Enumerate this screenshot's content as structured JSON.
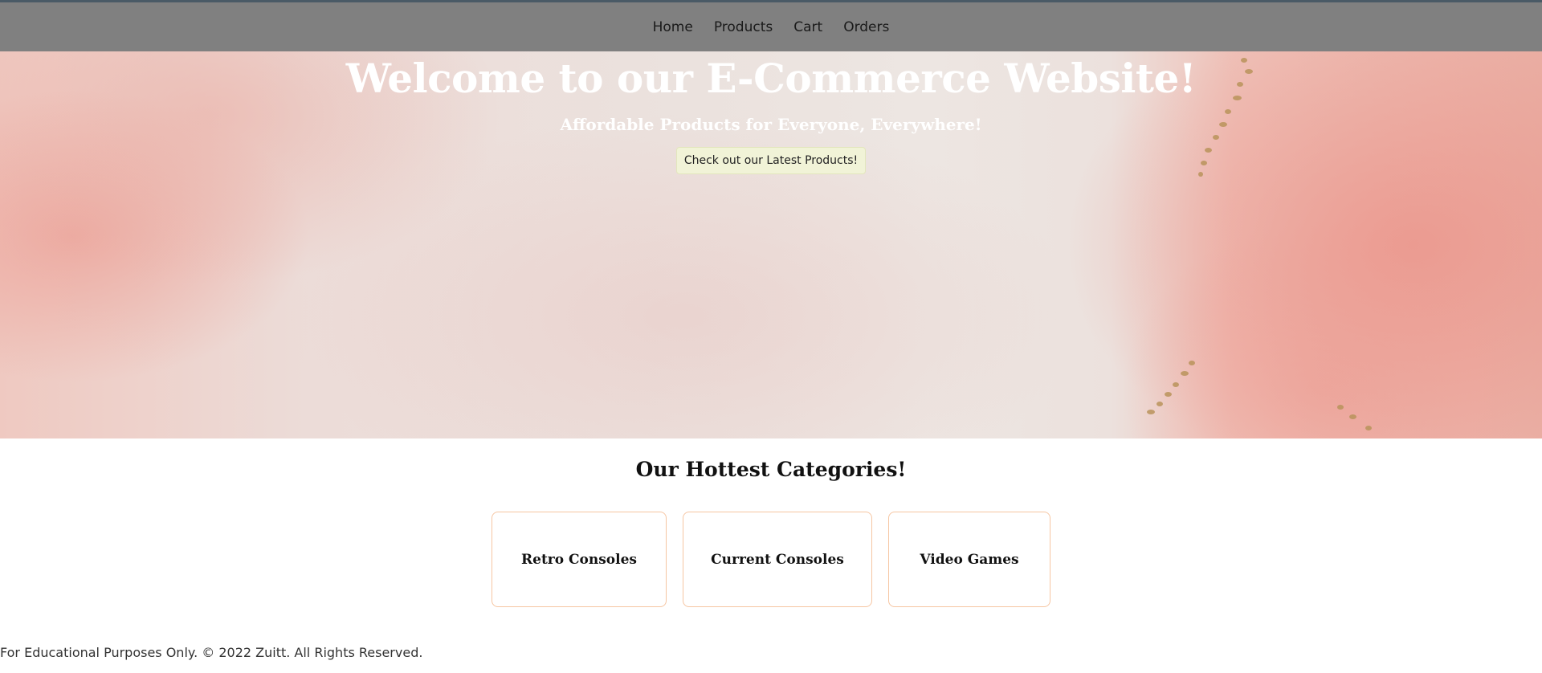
{
  "nav": {
    "links": [
      "Home",
      "Products",
      "Cart",
      "Orders"
    ]
  },
  "hero": {
    "title": "Welcome to our E-Commerce Website!",
    "subtitle": "Affordable Products for Everyone, Everywhere!",
    "button_label": "Check out our Latest Products!"
  },
  "categories": {
    "title": "Our Hottest Categories!",
    "items": [
      "Retro Consoles",
      "Current Consoles",
      "Video Games"
    ]
  },
  "footer": {
    "text": "For Educational Purposes Only. © 2022 Zuitt. All Rights Reserved."
  },
  "colors": {
    "navbar": "#808080",
    "card_border": "#f6c6a2",
    "button_bg": "#f1f3d7"
  }
}
